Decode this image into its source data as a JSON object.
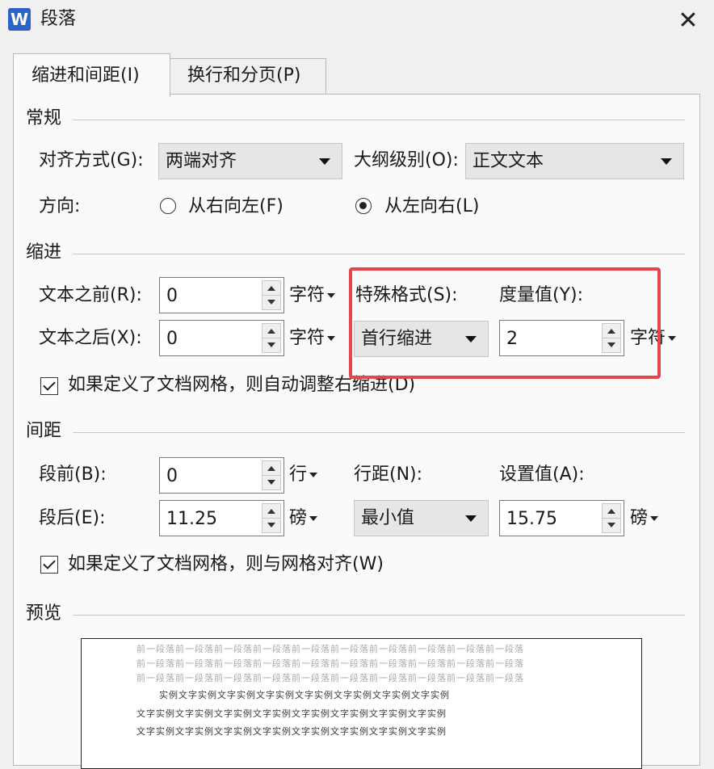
{
  "window": {
    "app_icon_letter": "W",
    "title": "段落",
    "close_glyph": "✕"
  },
  "tabs": [
    {
      "label": "缩进和间距(I)",
      "active": true
    },
    {
      "label": "换行和分页(P)",
      "active": false
    }
  ],
  "general": {
    "heading": "常规",
    "alignment_label": "对齐方式(G):",
    "alignment_value": "两端对齐",
    "outline_label": "大纲级别(O):",
    "outline_value": "正文文本",
    "direction_label": "方向:",
    "rtl_label": "从右向左(F)",
    "ltr_label": "从左向右(L)"
  },
  "indent": {
    "heading": "缩进",
    "before_label": "文本之前(R):",
    "before_value": "0",
    "before_unit": "字符",
    "after_label": "文本之后(X):",
    "after_value": "0",
    "after_unit": "字符",
    "special_label": "特殊格式(S):",
    "special_value": "首行缩进",
    "measure_label": "度量值(Y):",
    "measure_value": "2",
    "measure_unit": "字符",
    "auto_adjust_label": "如果定义了文档网格，则自动调整右缩进(D)"
  },
  "spacing": {
    "heading": "间距",
    "before_label": "段前(B):",
    "before_value": "0",
    "before_unit": "行",
    "after_label": "段后(E):",
    "after_value": "11.25",
    "after_unit": "磅",
    "line_label": "行距(N):",
    "line_value": "最小值",
    "setting_label": "设置值(A):",
    "setting_value": "15.75",
    "setting_unit": "磅",
    "snap_grid_label": "如果定义了文档网格，则与网格对齐(W)"
  },
  "preview": {
    "heading": "预览",
    "prev_lines": [
      "前一段落前一段落前一段落前一段落前一段落前一段落前一段落前一段落前一段落前一段落",
      "前一段落前一段落前一段落前一段落前一段落前一段落前一段落前一段落前一段落前一段落",
      "前一段落前一段落前一段落前一段落前一段落前一段落前一段落前一段落前一段落前一段落"
    ],
    "sample_lines": [
      "实例文字实例文字实例文字实例文字实例文字实例文字实例文字实例",
      "文字实例文字实例文字实例文字实例文字实例文字实例文字实例文字实例",
      "文字实例文字实例文字实例文字实例文字实例文字实例文字实例文字实例"
    ]
  },
  "colors": {
    "highlight": "#e5454c",
    "app_icon": "#2b64c6"
  }
}
